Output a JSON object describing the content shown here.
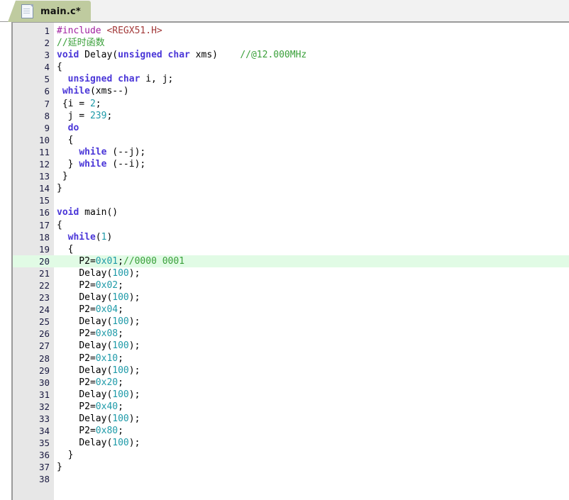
{
  "window": {
    "title": "main.c*"
  },
  "tab_bar": {
    "icon": "c-source-file-icon",
    "tabs": [
      {
        "label": "main.c*",
        "active": true,
        "modified": true
      }
    ]
  },
  "colors": {
    "tab_active_bg": "#bfcb9f",
    "tab_strip_bg": "#f2f2f2",
    "gutter_bg": "#e7e7e7",
    "editor_bg": "#ffffff",
    "current_line_highlight": "#e1fbe5",
    "border": "#9a9a9a",
    "line_number": "#1a1a40",
    "keyword": "#4a36d8",
    "preprocessor": "#a020a0",
    "include_path": "#a33a3a",
    "comment": "#3aa03a",
    "number": "#1e9aa8",
    "text": "#000000"
  },
  "editor": {
    "language": "c",
    "current_line": 20,
    "total_lines": 38,
    "lines": [
      {
        "n": 1,
        "tokens": [
          {
            "t": "preproc",
            "v": "#include"
          },
          {
            "t": "plain",
            "v": " "
          },
          {
            "t": "include",
            "v": "<REGX51.H>"
          }
        ]
      },
      {
        "n": 2,
        "tokens": [
          {
            "t": "comment",
            "v": "//延时函数"
          }
        ]
      },
      {
        "n": 3,
        "tokens": [
          {
            "t": "keyword",
            "v": "void"
          },
          {
            "t": "plain",
            "v": " "
          },
          {
            "t": "ident",
            "v": "Delay"
          },
          {
            "t": "plain",
            "v": "("
          },
          {
            "t": "keyword",
            "v": "unsigned char"
          },
          {
            "t": "plain",
            "v": " xms)    "
          },
          {
            "t": "comment",
            "v": "//@12.000MHz"
          }
        ]
      },
      {
        "n": 4,
        "tokens": [
          {
            "t": "plain",
            "v": "{"
          }
        ]
      },
      {
        "n": 5,
        "tokens": [
          {
            "t": "plain",
            "v": "  "
          },
          {
            "t": "keyword",
            "v": "unsigned char"
          },
          {
            "t": "plain",
            "v": " i, j;"
          }
        ]
      },
      {
        "n": 6,
        "tokens": [
          {
            "t": "plain",
            "v": " "
          },
          {
            "t": "keyword",
            "v": "while"
          },
          {
            "t": "plain",
            "v": "(xms--)"
          }
        ]
      },
      {
        "n": 7,
        "tokens": [
          {
            "t": "plain",
            "v": " {i = "
          },
          {
            "t": "number",
            "v": "2"
          },
          {
            "t": "plain",
            "v": ";"
          }
        ]
      },
      {
        "n": 8,
        "tokens": [
          {
            "t": "plain",
            "v": "  j = "
          },
          {
            "t": "number",
            "v": "239"
          },
          {
            "t": "plain",
            "v": ";"
          }
        ]
      },
      {
        "n": 9,
        "tokens": [
          {
            "t": "plain",
            "v": "  "
          },
          {
            "t": "keyword",
            "v": "do"
          }
        ]
      },
      {
        "n": 10,
        "tokens": [
          {
            "t": "plain",
            "v": "  {"
          }
        ]
      },
      {
        "n": 11,
        "tokens": [
          {
            "t": "plain",
            "v": "    "
          },
          {
            "t": "keyword",
            "v": "while"
          },
          {
            "t": "plain",
            "v": " (--j);"
          }
        ]
      },
      {
        "n": 12,
        "tokens": [
          {
            "t": "plain",
            "v": "  } "
          },
          {
            "t": "keyword",
            "v": "while"
          },
          {
            "t": "plain",
            "v": " (--i);"
          }
        ]
      },
      {
        "n": 13,
        "tokens": [
          {
            "t": "plain",
            "v": " }"
          }
        ]
      },
      {
        "n": 14,
        "tokens": [
          {
            "t": "plain",
            "v": "}"
          }
        ]
      },
      {
        "n": 15,
        "tokens": []
      },
      {
        "n": 16,
        "tokens": [
          {
            "t": "keyword",
            "v": "void"
          },
          {
            "t": "plain",
            "v": " "
          },
          {
            "t": "ident",
            "v": "main"
          },
          {
            "t": "plain",
            "v": "()"
          }
        ]
      },
      {
        "n": 17,
        "tokens": [
          {
            "t": "plain",
            "v": "{"
          }
        ]
      },
      {
        "n": 18,
        "tokens": [
          {
            "t": "plain",
            "v": "  "
          },
          {
            "t": "keyword",
            "v": "while"
          },
          {
            "t": "plain",
            "v": "("
          },
          {
            "t": "number",
            "v": "1"
          },
          {
            "t": "plain",
            "v": ")"
          }
        ]
      },
      {
        "n": 19,
        "tokens": [
          {
            "t": "plain",
            "v": "  {"
          }
        ]
      },
      {
        "n": 20,
        "tokens": [
          {
            "t": "plain",
            "v": "    P2="
          },
          {
            "t": "number",
            "v": "0x01"
          },
          {
            "t": "plain",
            "v": ";"
          },
          {
            "t": "comment",
            "v": "//0000 0001"
          }
        ],
        "highlighted": true
      },
      {
        "n": 21,
        "tokens": [
          {
            "t": "plain",
            "v": "    "
          },
          {
            "t": "ident",
            "v": "Delay"
          },
          {
            "t": "plain",
            "v": "("
          },
          {
            "t": "number",
            "v": "100"
          },
          {
            "t": "plain",
            "v": ");"
          }
        ]
      },
      {
        "n": 22,
        "tokens": [
          {
            "t": "plain",
            "v": "    P2="
          },
          {
            "t": "number",
            "v": "0x02"
          },
          {
            "t": "plain",
            "v": ";"
          }
        ]
      },
      {
        "n": 23,
        "tokens": [
          {
            "t": "plain",
            "v": "    "
          },
          {
            "t": "ident",
            "v": "Delay"
          },
          {
            "t": "plain",
            "v": "("
          },
          {
            "t": "number",
            "v": "100"
          },
          {
            "t": "plain",
            "v": ");"
          }
        ]
      },
      {
        "n": 24,
        "tokens": [
          {
            "t": "plain",
            "v": "    P2="
          },
          {
            "t": "number",
            "v": "0x04"
          },
          {
            "t": "plain",
            "v": ";"
          }
        ]
      },
      {
        "n": 25,
        "tokens": [
          {
            "t": "plain",
            "v": "    "
          },
          {
            "t": "ident",
            "v": "Delay"
          },
          {
            "t": "plain",
            "v": "("
          },
          {
            "t": "number",
            "v": "100"
          },
          {
            "t": "plain",
            "v": ");"
          }
        ]
      },
      {
        "n": 26,
        "tokens": [
          {
            "t": "plain",
            "v": "    P2="
          },
          {
            "t": "number",
            "v": "0x08"
          },
          {
            "t": "plain",
            "v": ";"
          }
        ]
      },
      {
        "n": 27,
        "tokens": [
          {
            "t": "plain",
            "v": "    "
          },
          {
            "t": "ident",
            "v": "Delay"
          },
          {
            "t": "plain",
            "v": "("
          },
          {
            "t": "number",
            "v": "100"
          },
          {
            "t": "plain",
            "v": ");"
          }
        ]
      },
      {
        "n": 28,
        "tokens": [
          {
            "t": "plain",
            "v": "    P2="
          },
          {
            "t": "number",
            "v": "0x10"
          },
          {
            "t": "plain",
            "v": ";"
          }
        ]
      },
      {
        "n": 29,
        "tokens": [
          {
            "t": "plain",
            "v": "    "
          },
          {
            "t": "ident",
            "v": "Delay"
          },
          {
            "t": "plain",
            "v": "("
          },
          {
            "t": "number",
            "v": "100"
          },
          {
            "t": "plain",
            "v": ");"
          }
        ]
      },
      {
        "n": 30,
        "tokens": [
          {
            "t": "plain",
            "v": "    P2="
          },
          {
            "t": "number",
            "v": "0x20"
          },
          {
            "t": "plain",
            "v": ";"
          }
        ]
      },
      {
        "n": 31,
        "tokens": [
          {
            "t": "plain",
            "v": "    "
          },
          {
            "t": "ident",
            "v": "Delay"
          },
          {
            "t": "plain",
            "v": "("
          },
          {
            "t": "number",
            "v": "100"
          },
          {
            "t": "plain",
            "v": ");"
          }
        ]
      },
      {
        "n": 32,
        "tokens": [
          {
            "t": "plain",
            "v": "    P2="
          },
          {
            "t": "number",
            "v": "0x40"
          },
          {
            "t": "plain",
            "v": ";"
          }
        ]
      },
      {
        "n": 33,
        "tokens": [
          {
            "t": "plain",
            "v": "    "
          },
          {
            "t": "ident",
            "v": "Delay"
          },
          {
            "t": "plain",
            "v": "("
          },
          {
            "t": "number",
            "v": "100"
          },
          {
            "t": "plain",
            "v": ");"
          }
        ]
      },
      {
        "n": 34,
        "tokens": [
          {
            "t": "plain",
            "v": "    P2="
          },
          {
            "t": "number",
            "v": "0x80"
          },
          {
            "t": "plain",
            "v": ";"
          }
        ]
      },
      {
        "n": 35,
        "tokens": [
          {
            "t": "plain",
            "v": "    "
          },
          {
            "t": "ident",
            "v": "Delay"
          },
          {
            "t": "plain",
            "v": "("
          },
          {
            "t": "number",
            "v": "100"
          },
          {
            "t": "plain",
            "v": ");"
          }
        ]
      },
      {
        "n": 36,
        "tokens": [
          {
            "t": "plain",
            "v": "  }"
          }
        ]
      },
      {
        "n": 37,
        "tokens": [
          {
            "t": "plain",
            "v": "}"
          }
        ]
      },
      {
        "n": 38,
        "tokens": []
      }
    ]
  }
}
